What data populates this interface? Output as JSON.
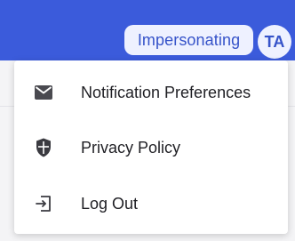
{
  "header": {
    "impersonating_label": "Impersonating",
    "avatar_initials": "TA",
    "accent_color": "#3b5bdb"
  },
  "menu": {
    "items": [
      {
        "label": "Notification Preferences",
        "icon": "envelope-icon"
      },
      {
        "label": "Privacy Policy",
        "icon": "shield-icon"
      },
      {
        "label": "Log Out",
        "icon": "logout-icon"
      }
    ]
  }
}
